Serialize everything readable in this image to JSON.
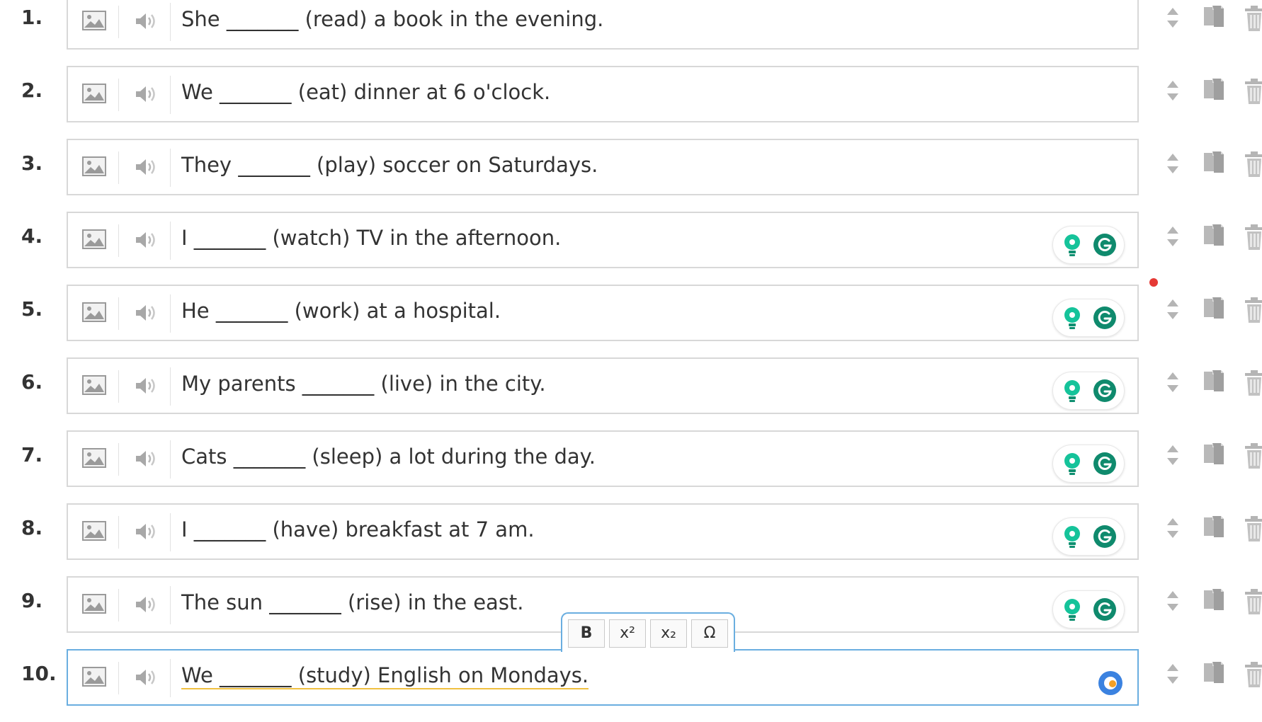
{
  "questions": [
    {
      "number": "1.",
      "text": "She _______ (read) a book in the evening.",
      "status": "none"
    },
    {
      "number": "2.",
      "text": "We _______ (eat) dinner at 6 o'clock.",
      "status": "none"
    },
    {
      "number": "3.",
      "text": "They _______ (play) soccer on Saturdays.",
      "status": "none"
    },
    {
      "number": "4.",
      "text": "I _______ (watch) TV in the afternoon.",
      "status": "extension"
    },
    {
      "number": "5.",
      "text": "He _______ (work) at a hospital.",
      "status": "extension"
    },
    {
      "number": "6.",
      "text": "My parents _______ (live) in the city.",
      "status": "extension"
    },
    {
      "number": "7.",
      "text": "Cats _______ (sleep) a lot during the day.",
      "status": "extension"
    },
    {
      "number": "8.",
      "text": "I _______ (have) breakfast at 7 am.",
      "status": "extension"
    },
    {
      "number": "9.",
      "text": "The sun _______ (rise) in the east.",
      "status": "extension"
    },
    {
      "number": "10.",
      "text": "We _______ (study) English on Mondays.",
      "status": "active"
    }
  ],
  "toolbar": {
    "bold": "B",
    "superscript": "x²",
    "subscript": "x₂",
    "special_char": "Ω"
  },
  "icons": {
    "image": "image-icon",
    "audio": "speaker-icon",
    "sort": "sort-arrows-icon",
    "copy": "copy-icon",
    "delete": "trash-icon",
    "hint": "lightbulb-icon",
    "grammar": "grammarly-icon"
  },
  "colors": {
    "border": "#d8d8d8",
    "active_border": "#6aaee0",
    "grammarly": "#15c39a",
    "status_dot": "#e53935"
  }
}
